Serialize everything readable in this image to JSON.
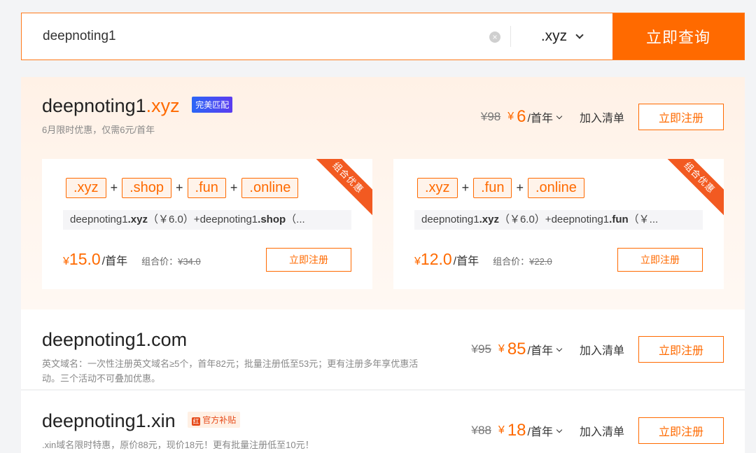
{
  "search": {
    "value": "deepnoting1",
    "clear_icon": "×",
    "suffix": ".xyz",
    "query_label": "立即查询"
  },
  "featured": {
    "domain_name": "deepnoting1",
    "domain_ext": ".xyz",
    "match_tag": "完美匹配",
    "desc": "6月限时优惠，仅需6元/首年",
    "old_price": "¥98",
    "currency": "¥",
    "price": "6",
    "per_year": "/首年",
    "add_list": "加入清单",
    "register": "立即注册"
  },
  "combos": [
    {
      "chips": [
        ".xyz",
        ".shop",
        ".fun",
        ".online"
      ],
      "plus": "+",
      "detail_prefix1": "deepnoting1",
      "detail_ext1": ".xyz",
      "detail_mid": "（￥6.0）+deepnoting1",
      "detail_ext2": ".shop",
      "detail_tail": "（...",
      "currency": "¥",
      "price": "15.0",
      "per_year": "/首年",
      "orig_label": "组合价：",
      "orig_price": "¥34.0",
      "register": "立即注册",
      "ribbon": "组合优惠"
    },
    {
      "chips": [
        ".xyz",
        ".fun",
        ".online"
      ],
      "plus": "+",
      "detail_prefix1": "deepnoting1",
      "detail_ext1": ".xyz",
      "detail_mid": "（￥6.0）+deepnoting1",
      "detail_ext2": ".fun",
      "detail_tail": "（￥...",
      "currency": "¥",
      "price": "12.0",
      "per_year": "/首年",
      "orig_label": "组合价：",
      "orig_price": "¥22.0",
      "register": "立即注册",
      "ribbon": "组合优惠"
    }
  ],
  "rows": [
    {
      "domain": "deepnoting1.com",
      "desc": "英文域名：一次性注册英文域名≥5个，首年82元；批量注册低至53元；更有注册多年享优惠活动。三个活动不可叠加优惠。",
      "old_price": "¥95",
      "currency": "¥",
      "price": "85",
      "per_year": "/首年",
      "add_list": "加入清单",
      "register": "立即注册"
    },
    {
      "domain": "deepnoting1.xin",
      "tag": "官方补贴",
      "tag_icon": "红",
      "desc": ".xin域名限时特惠，原价88元，现价18元！更有批量注册低至10元！",
      "old_price": "¥88",
      "currency": "¥",
      "price": "18",
      "per_year": "/首年",
      "add_list": "加入清单",
      "register": "立即注册"
    }
  ],
  "colors": {
    "accent": "#ff6a00",
    "match_tag": "#2b66f6",
    "ribbon": "#f25a21"
  }
}
